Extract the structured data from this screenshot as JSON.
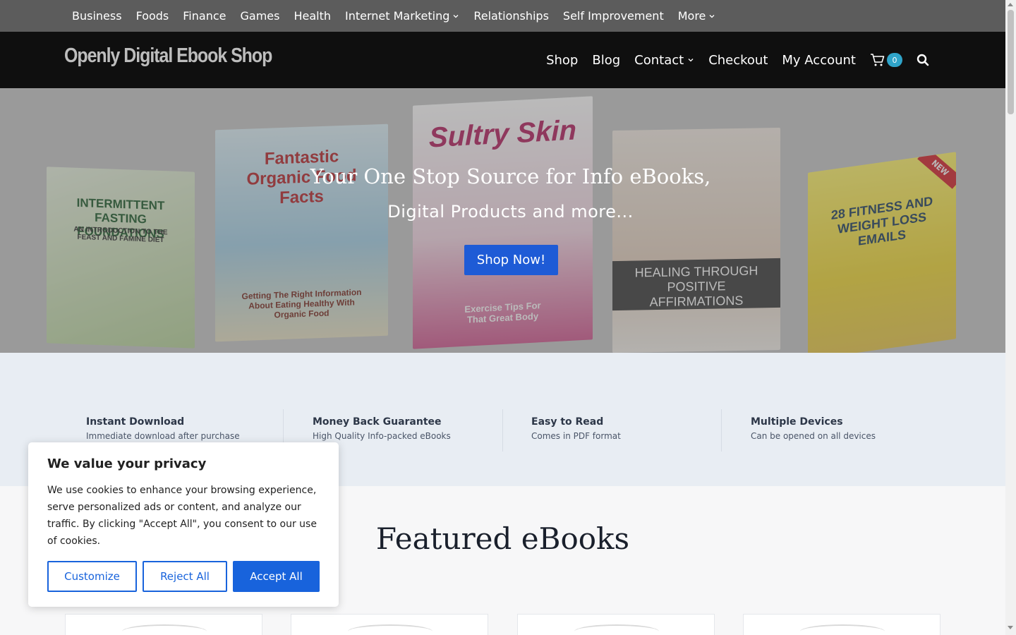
{
  "topbar": {
    "items": [
      {
        "label": "Business",
        "dropdown": false
      },
      {
        "label": "Foods",
        "dropdown": false
      },
      {
        "label": "Finance",
        "dropdown": false
      },
      {
        "label": "Games",
        "dropdown": false
      },
      {
        "label": "Health",
        "dropdown": false
      },
      {
        "label": "Internet Marketing",
        "dropdown": true
      },
      {
        "label": "Relationships",
        "dropdown": false
      },
      {
        "label": "Self Improvement",
        "dropdown": false
      },
      {
        "label": "More",
        "dropdown": true
      }
    ]
  },
  "header": {
    "logo": "Openly Digital Ebook Shop",
    "nav": [
      {
        "label": "Shop",
        "dropdown": false
      },
      {
        "label": "Blog",
        "dropdown": false
      },
      {
        "label": "Contact",
        "dropdown": true
      },
      {
        "label": "Checkout",
        "dropdown": false
      },
      {
        "label": "My Account",
        "dropdown": false
      }
    ],
    "cart_count": "0",
    "icons": {
      "cart": "cart-icon",
      "search": "search-icon"
    }
  },
  "hero": {
    "title": "Your One Stop Source for Info eBooks,",
    "subtitle": "Digital Products and more...",
    "button": "Shop Now!",
    "books": [
      {
        "title": "INTERMITTENT FASTING FOUNDATIONS",
        "subtitle": "AN INTRODUCTION TO THE FEAST AND FAMINE DIET"
      },
      {
        "title": "Fantastic Organic Food Facts",
        "subtitle": "Getting The Right Information About Eating Healthy With Organic Food"
      },
      {
        "title": "Sultry Skin",
        "subtitle": "Exercise Tips For That Great Body"
      },
      {
        "title": "HEALING THROUGH POSITIVE AFFIRMATIONS",
        "subtitle": ""
      },
      {
        "title": "28 FITNESS AND WEIGHT LOSS EMAILS",
        "subtitle": "NEW"
      }
    ]
  },
  "features": [
    {
      "title": "Instant Download",
      "desc": "Immediate download after purchase"
    },
    {
      "title": "Money Back Guarantee",
      "desc": "High Quality Info-packed eBooks"
    },
    {
      "title": "Easy to Read",
      "desc": "Comes in PDF format"
    },
    {
      "title": "Multiple Devices",
      "desc": "Can be opened on all devices"
    }
  ],
  "featured": {
    "title": "Featured eBooks"
  },
  "cookie": {
    "title": "We value your privacy",
    "text": "We use cookies to enhance your browsing experience, serve personalized ads or content, and analyze our traffic. By clicking \"Accept All\", you consent to our use of cookies.",
    "customize": "Customize",
    "reject": "Reject All",
    "accept": "Accept All"
  },
  "colors": {
    "topbar_bg": "#5c5c5c",
    "header_bg": "#0f0f0f",
    "accent": "#1e5bd6",
    "cart_badge": "#2fa4c9",
    "cookie_accent": "#1863dc"
  }
}
